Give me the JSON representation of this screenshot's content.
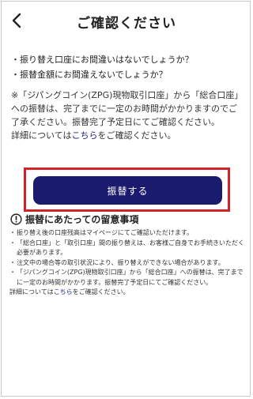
{
  "header": {
    "title": "ご確認ください",
    "back_icon": "chevron-left-icon"
  },
  "checks": [
    "・振り替え口座にお間違いはないでしょうか？",
    "・振替金額にお間違えないでしょうか？"
  ],
  "note": {
    "line1": "※「ジパングコイン(ZPG)現物取引口座」から「総合口座」への振替は、完了までに一定のお時間がかかりますのでご了承ください。振替完了予定日にてご確認ください。",
    "prefix": "詳細については",
    "link": "こちら",
    "suffix": "をご確認ください。"
  },
  "transfer_button": {
    "label": "振替する"
  },
  "notice": {
    "icon": "exclamation-circle-icon",
    "title": "振替にあたっての留意事項",
    "items": [
      "振り替え後の口座残高はマイページにてご確認いただけます。",
      "「総合口座」と「取引口座」間の振り替えは、お客様ご自身でお手続きいただく必要があります。",
      "注文中の場合等の取引状況により、振り替えができない場合があります。",
      "「ジパングコイン(ZPG)現物取引口座」から「総合口座」への振替は、完了までに一定のお時間がかかります。振替完了予定日にてご確認ください。"
    ],
    "detail_prefix": "詳細については",
    "detail_link": "こちら",
    "detail_suffix": "をご確認ください。"
  },
  "colors": {
    "button": "#1a1a6e",
    "highlight_border": "#d3232a",
    "link": "#1a237e"
  }
}
